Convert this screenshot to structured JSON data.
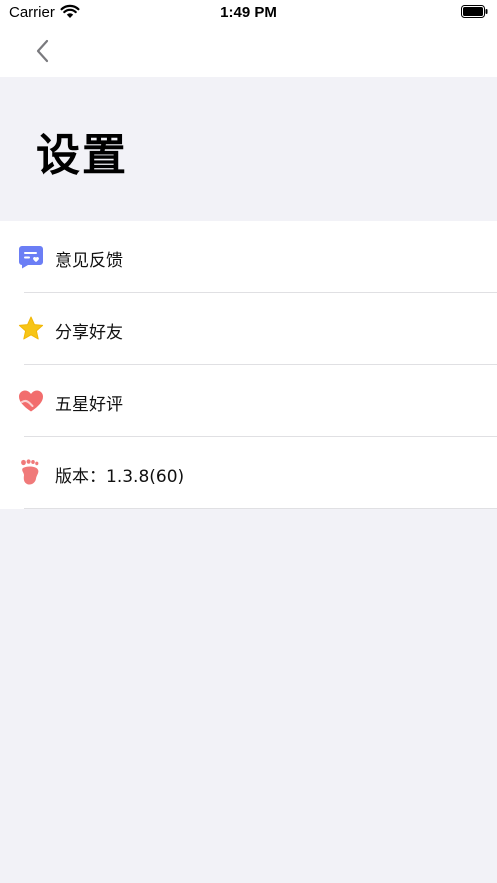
{
  "status_bar": {
    "carrier": "Carrier",
    "time": "1:49 PM"
  },
  "nav": {
    "back_icon": "chevron-left-icon"
  },
  "page": {
    "title": "设置"
  },
  "settings": {
    "items": [
      {
        "label": "意见反馈",
        "icon": "feedback-icon",
        "color": "#6b7ef5"
      },
      {
        "label": "分享好友",
        "icon": "star-icon",
        "color": "#f7c517"
      },
      {
        "label": "五星好评",
        "icon": "heart-icon",
        "color": "#f26d6d"
      },
      {
        "label": "版本：1.3.8(60)",
        "icon": "footprint-icon",
        "color": "#f07a7a"
      }
    ]
  },
  "colors": {
    "background": "#f2f2f7",
    "surface": "#ffffff",
    "separator": "#e0e0e3"
  }
}
